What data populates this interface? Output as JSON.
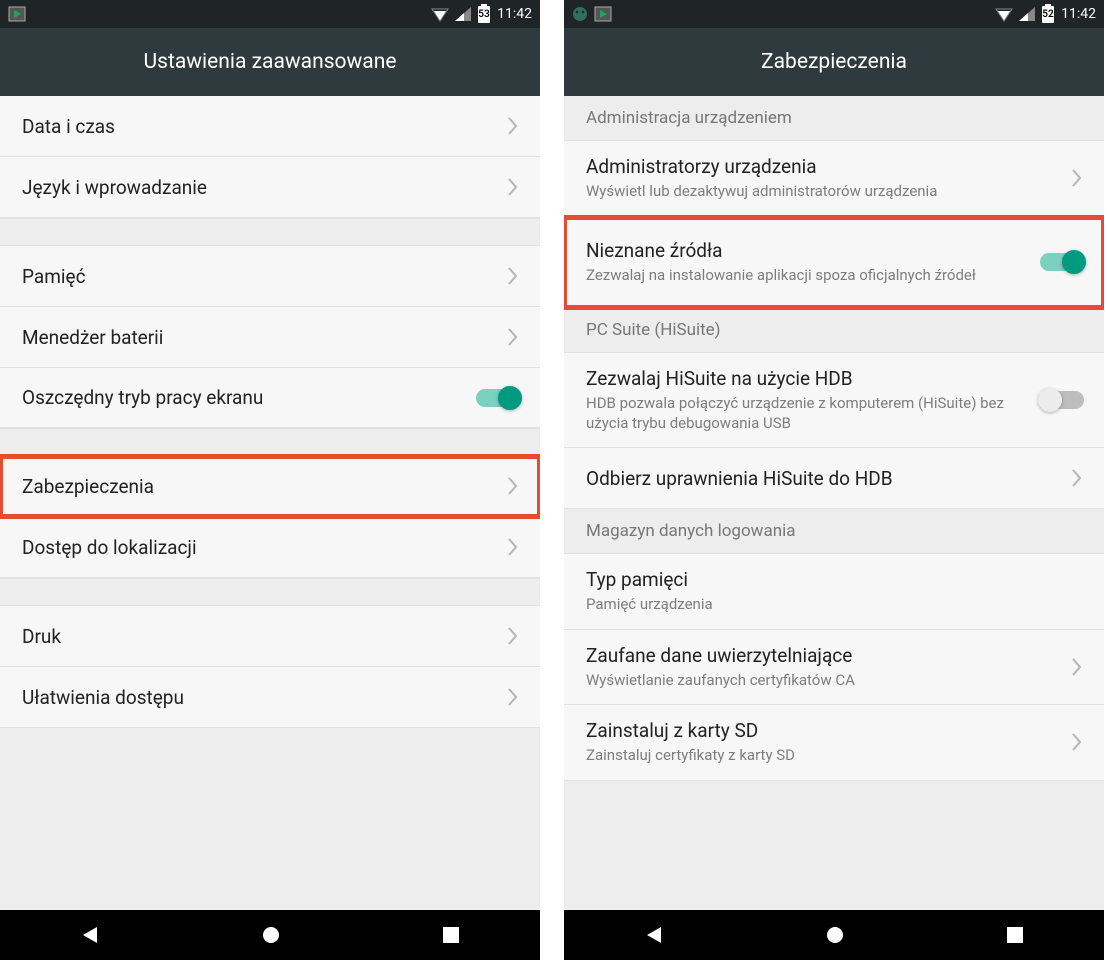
{
  "left": {
    "status_time": "11:42",
    "battery": "53",
    "title": "Ustawienia zaawansowane",
    "items": {
      "date_time": "Data i czas",
      "lang_input": "Język i wprowadzanie",
      "storage": "Pamięć",
      "battery_mgr": "Menedżer baterii",
      "screen_saver": "Oszczędny tryb pracy ekranu",
      "security": "Zabezpieczenia",
      "location": "Dostęp do lokalizacji",
      "print": "Druk",
      "accessibility": "Ułatwienia dostępu"
    }
  },
  "right": {
    "status_time": "11:42",
    "battery": "52",
    "title": "Zabezpieczenia",
    "sections": {
      "device_admin": "Administracja urządzeniem",
      "pc_suite": "PC Suite (HiSuite)",
      "cred_storage": "Magazyn danych logowania"
    },
    "items": {
      "device_admins": {
        "t": "Administratorzy urządzenia",
        "s": "Wyświetl lub dezaktywuj administratorów urządzenia"
      },
      "unknown_sources": {
        "t": "Nieznane źródła",
        "s": "Zezwalaj na instalowanie aplikacji spoza oficjalnych źródeł"
      },
      "hdb_allow": {
        "t": "Zezwalaj HiSuite na użycie HDB",
        "s": "HDB pozwala połączyć urządzenie z komputerem (HiSuite) bez użycia trybu debugowania USB"
      },
      "hdb_revoke": {
        "t": "Odbierz uprawnienia HiSuite do HDB"
      },
      "storage_type": {
        "t": "Typ pamięci",
        "s": "Pamięć urządzenia"
      },
      "trusted_creds": {
        "t": "Zaufane dane uwierzytelniające",
        "s": "Wyświetlanie zaufanych certyfikatów CA"
      },
      "install_sd": {
        "t": "Zainstaluj z karty SD",
        "s": "Zainstaluj certyfikaty z karty SD"
      }
    }
  }
}
